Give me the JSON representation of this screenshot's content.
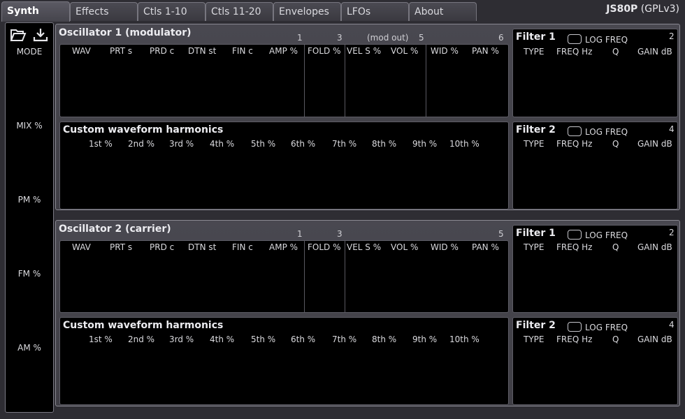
{
  "tabs": [
    "Synth",
    "Effects",
    "Ctls 1-10",
    "Ctls 11-20",
    "Envelopes",
    "LFOs",
    "About"
  ],
  "brand": {
    "name": "JS80P",
    "license": "(GPLv3)"
  },
  "left": {
    "icons": [
      "folder-open-icon",
      "download-icon"
    ],
    "labels": [
      "MODE",
      "MIX %",
      "PM %",
      "FM %",
      "AM %"
    ]
  },
  "osc1": {
    "title": "Oscillator 1 (modulator)",
    "numbers": [
      "1",
      "3",
      "(mod out)",
      "5",
      "6"
    ],
    "columns": [
      "WAV",
      "PRT s",
      "PRD c",
      "DTN st",
      "FIN c",
      "AMP %",
      "FOLD %",
      "VEL S %",
      "VOL %",
      "WID %",
      "PAN %"
    ]
  },
  "osc2": {
    "title": "Oscillator 2 (carrier)",
    "numbers": [
      "1",
      "3",
      "5"
    ],
    "columns": [
      "WAV",
      "PRT s",
      "PRD c",
      "DTN st",
      "FIN c",
      "AMP %",
      "FOLD %",
      "VEL S %",
      "VOL %",
      "WID %",
      "PAN %"
    ]
  },
  "harmonics": {
    "title": "Custom waveform harmonics",
    "columns": [
      "1st %",
      "2nd %",
      "3rd %",
      "4th %",
      "5th %",
      "6th %",
      "7th %",
      "8th %",
      "9th %",
      "10th %"
    ]
  },
  "filter1": {
    "title": "Filter 1",
    "log": "LOG FREQ",
    "num": "2",
    "columns": [
      "TYPE",
      "FREQ Hz",
      "Q",
      "GAIN dB"
    ]
  },
  "filter2": {
    "title": "Filter 2",
    "log": "LOG FREQ",
    "num": "4",
    "columns": [
      "TYPE",
      "FREQ Hz",
      "Q",
      "GAIN dB"
    ]
  }
}
